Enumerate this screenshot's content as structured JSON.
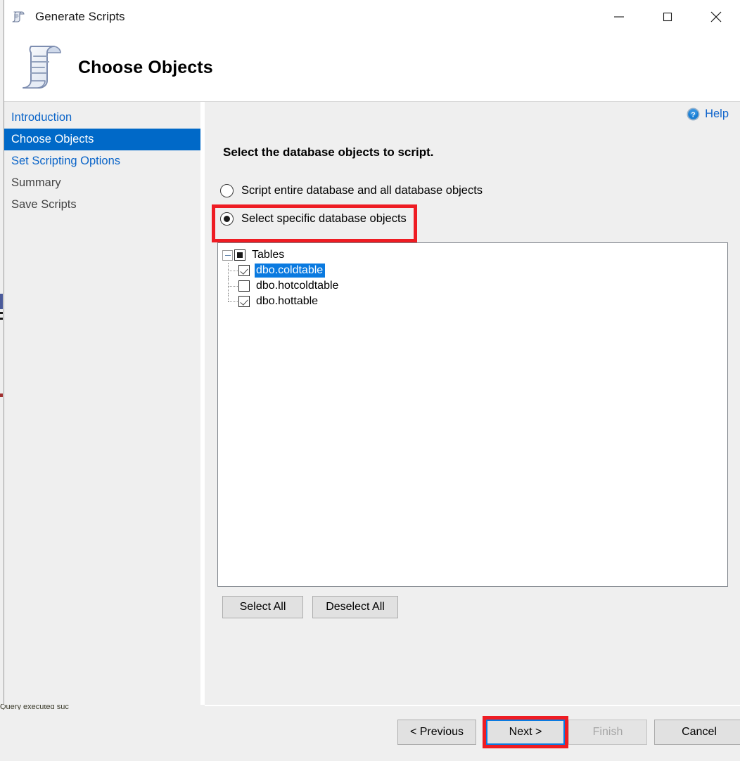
{
  "window": {
    "title": "Generate Scripts",
    "icon": "scroll-icon",
    "controls": {
      "minimize": "minimize-icon",
      "maximize": "maximize-icon",
      "close": "close-icon"
    }
  },
  "header": {
    "title": "Choose Objects",
    "icon": "scroll-document-icon"
  },
  "sidebar": {
    "items": [
      {
        "label": "Introduction",
        "state": "link"
      },
      {
        "label": "Choose Objects",
        "state": "active"
      },
      {
        "label": "Set Scripting Options",
        "state": "link"
      },
      {
        "label": "Summary",
        "state": "plain"
      },
      {
        "label": "Save Scripts",
        "state": "plain"
      }
    ]
  },
  "content": {
    "help": {
      "label": "Help",
      "icon": "help-circle-icon"
    },
    "instruction": "Select the database objects to script.",
    "radios": [
      {
        "label": "Script entire database and all database objects",
        "checked": false
      },
      {
        "label": "Select specific database objects",
        "checked": true
      }
    ],
    "tree": {
      "root": {
        "label": "Tables",
        "check_state": "indeterminate",
        "expanded": true
      },
      "children": [
        {
          "label": "dbo.coldtable",
          "check_state": "checked",
          "selected": true
        },
        {
          "label": "dbo.hotcoldtable",
          "check_state": "unchecked",
          "selected": false
        },
        {
          "label": "dbo.hottable",
          "check_state": "checked",
          "selected": false
        }
      ]
    },
    "selection_buttons": [
      {
        "label": "Select All"
      },
      {
        "label": "Deselect All"
      }
    ]
  },
  "footer": {
    "buttons": [
      {
        "label": "< Previous",
        "state": "normal"
      },
      {
        "label": "Next >",
        "state": "focused"
      },
      {
        "label": "Finish",
        "state": "disabled"
      },
      {
        "label": "Cancel",
        "state": "normal"
      }
    ]
  },
  "annotations": {
    "accent_color": "#ee1c23",
    "targets": [
      "Select specific database objects",
      "Next >"
    ]
  },
  "background": {
    "clipped_text": "Query executed suc"
  }
}
